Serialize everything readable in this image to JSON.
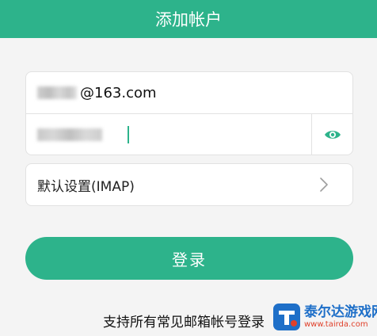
{
  "header": {
    "title": "添加帐户"
  },
  "login": {
    "email_suffix": "@163.com",
    "password_visibility_icon": "eye-icon"
  },
  "setting": {
    "protocol_label": "默认设置(IMAP)",
    "chevron_icon": "chevron-right-icon"
  },
  "actions": {
    "login_label": "登录"
  },
  "footer": {
    "note": "支持所有常见邮箱帐号登录"
  },
  "watermark": {
    "name": "泰尔达游戏网",
    "url": "www.tairda.com"
  },
  "colors": {
    "accent": "#2db38b",
    "background": "#f4f4f4",
    "card": "#ffffff",
    "watermark_blue": "#1e6fc8",
    "watermark_red": "#e0402a"
  }
}
